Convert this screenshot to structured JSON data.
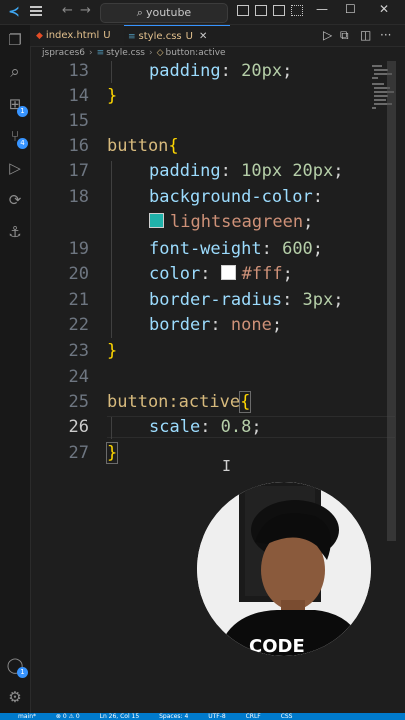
{
  "titlebar": {
    "search_text": "youtube",
    "back_icon": "arrow-left-icon",
    "forward_icon": "arrow-right-icon",
    "window_controls": [
      "minimize",
      "maximize",
      "close"
    ]
  },
  "tabs": [
    {
      "label": "index.html",
      "status": "U",
      "icon": "html-icon",
      "active": false
    },
    {
      "label": "style.css",
      "status": "U",
      "icon": "css-icon",
      "active": true
    }
  ],
  "tab_actions": [
    "run-icon",
    "compare-icon",
    "split-editor-icon",
    "more-icon"
  ],
  "breadcrumb": {
    "folder": "jspraces6",
    "file": "style.css",
    "symbol": "button:active"
  },
  "activity_bar": [
    {
      "name": "explorer-icon",
      "glyph": "❐"
    },
    {
      "name": "search-icon",
      "glyph": "⌕"
    },
    {
      "name": "extensions-icon",
      "glyph": "⊞",
      "badge": "1"
    },
    {
      "name": "source-control-icon",
      "glyph": "⑂",
      "badge": "4"
    },
    {
      "name": "run-debug-icon",
      "glyph": "▷"
    },
    {
      "name": "remote-icon",
      "glyph": "⟳"
    },
    {
      "name": "anchor-icon",
      "glyph": "⚓"
    },
    {
      "name": "account-icon",
      "glyph": "◯",
      "badge": "1"
    },
    {
      "name": "settings-icon",
      "glyph": "⚙"
    }
  ],
  "colors": {
    "lightseagreen": "#20b2aa",
    "white": "#ffffff",
    "accent": "#007acc"
  },
  "code": {
    "line_numbers": [
      "13",
      "14",
      "15",
      "16",
      "17",
      "18",
      "19",
      "20",
      "21",
      "22",
      "23",
      "24",
      "25",
      "26",
      "27"
    ],
    "l13_prop": "padding",
    "l13_val": "20px",
    "l16_sel": "button",
    "l17_prop": "padding",
    "l17_val": "10px 20px",
    "l18_prop": "background-color",
    "l18b_val": "lightseagreen",
    "l19_prop": "font-weight",
    "l19_val": "600",
    "l20_prop": "color",
    "l20_val": "#fff",
    "l21_prop": "border-radius",
    "l21_val": "3px",
    "l22_prop": "border",
    "l22_val": "none",
    "l25_sel": "button:active",
    "l26_prop": "scale",
    "l26_val": "0.8"
  },
  "webcam": {
    "shirt_text": "CODE"
  },
  "statusbar": {
    "items": [
      "main*",
      "⊗ 0 ⚠ 0",
      "Ln 26, Col 15",
      "Spaces: 4",
      "UTF-8",
      "CRLF",
      "CSS"
    ]
  }
}
